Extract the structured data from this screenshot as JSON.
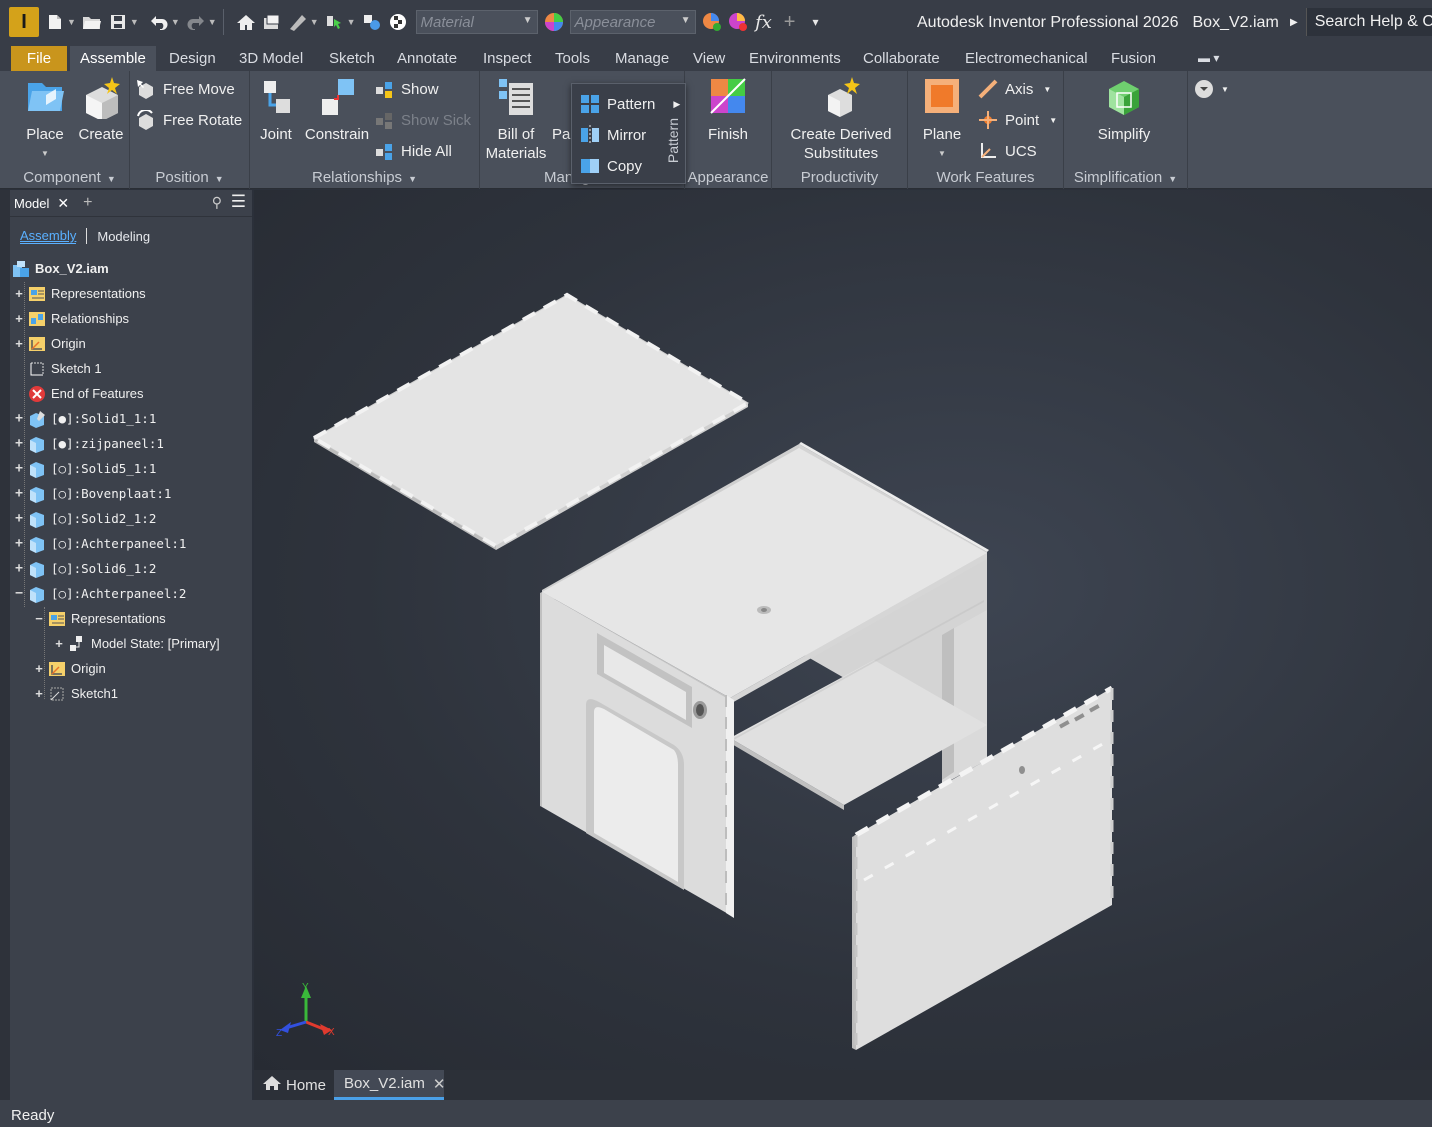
{
  "app": {
    "title": "Autodesk Inventor Professional 2026",
    "document": "Box_V2.iam",
    "logo_letter": "I",
    "search_label": "Search Help & Commands..."
  },
  "qat": {
    "material_placeholder": "Material",
    "appearance_placeholder": "Appearance",
    "fx_label": "fx"
  },
  "tabs": [
    {
      "label": "File"
    },
    {
      "label": "Assemble"
    },
    {
      "label": "Design"
    },
    {
      "label": "3D Model"
    },
    {
      "label": "Sketch"
    },
    {
      "label": "Annotate"
    },
    {
      "label": "Inspect"
    },
    {
      "label": "Tools"
    },
    {
      "label": "Manage"
    },
    {
      "label": "View"
    },
    {
      "label": "Environments"
    },
    {
      "label": "Collaborate"
    },
    {
      "label": "Electromechanical"
    },
    {
      "label": "Fusion"
    }
  ],
  "ribbon": {
    "component": {
      "footer": "Component",
      "place": "Place",
      "create": "Create"
    },
    "position": {
      "footer": "Position",
      "free_move": "Free Move",
      "free_rotate": "Free Rotate"
    },
    "relationships": {
      "footer": "Relationships",
      "joint": "Joint",
      "constrain": "Constrain",
      "show": "Show",
      "show_sick": "Show Sick",
      "hide_all": "Hide All"
    },
    "manage": {
      "footer": "Manage",
      "bom_line1": "Bill of",
      "bom_line2": "Materials",
      "param": "Par"
    },
    "pattern_menu": {
      "pattern": "Pattern",
      "mirror": "Mirror",
      "copy": "Copy",
      "vertical_label": "Pattern"
    },
    "appearance": {
      "footer": "Appearance",
      "finish": "Finish"
    },
    "productivity": {
      "footer": "Productivity",
      "line1": "Create Derived",
      "line2": "Substitutes"
    },
    "work_features": {
      "footer": "Work Features",
      "plane": "Plane",
      "axis": "Axis",
      "point": "Point",
      "ucs": "UCS"
    },
    "simplification": {
      "footer": "Simplification",
      "simplify": "Simplify"
    }
  },
  "browser": {
    "tab_label": "Model",
    "mode_assembly": "Assembly",
    "mode_modeling": "Modeling",
    "root": "Box_V2.iam",
    "nodes": [
      {
        "label": "Representations"
      },
      {
        "label": "Relationships"
      },
      {
        "label": "Origin"
      },
      {
        "label": "Sketch 1"
      },
      {
        "label": "End of Features"
      },
      {
        "label": "[●]:Solid1_1:1"
      },
      {
        "label": "[●]:zijpaneel:1"
      },
      {
        "label": "[○]:Solid5_1:1"
      },
      {
        "label": "[○]:Bovenplaat:1"
      },
      {
        "label": "[○]:Solid2_1:2"
      },
      {
        "label": "[○]:Achterpaneel:1"
      },
      {
        "label": "[○]:Solid6_1:2"
      },
      {
        "label": "[○]:Achterpaneel:2"
      },
      {
        "label": "Representations"
      },
      {
        "label": "Model State: [Primary]"
      },
      {
        "label": "Origin"
      },
      {
        "label": "Sketch1"
      }
    ]
  },
  "viewport": {
    "axis_x": "X",
    "axis_y": "Y",
    "axis_z": "Z",
    "colors": {
      "part": "#e2e2e2",
      "part_shade": "#c9c9c9",
      "part_dark": "#b3b3b3",
      "axis_x": "#e03a2e",
      "axis_y": "#3ab83a",
      "axis_z": "#3250e0"
    }
  },
  "doctabs": {
    "home": "Home",
    "doc": "Box_V2.iam"
  },
  "status": {
    "text": "Ready"
  }
}
